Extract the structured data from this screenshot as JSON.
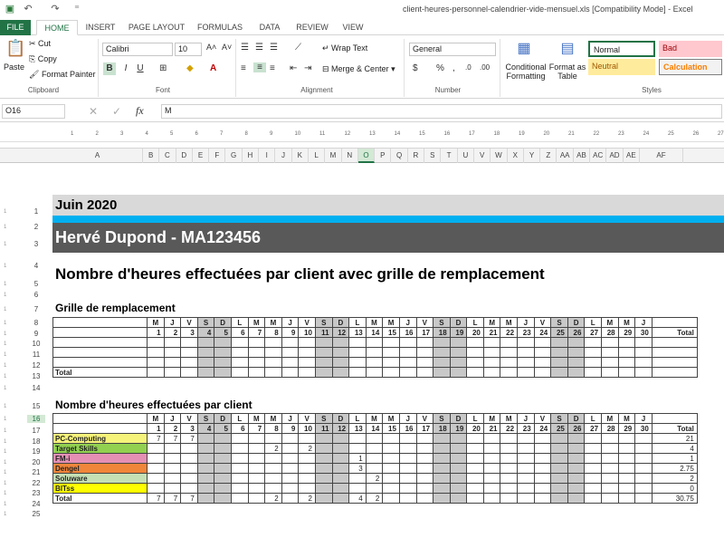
{
  "window": {
    "title": "client-heures-personnel-calendrier-vide-mensuel.xls  [Compatibility Mode] - Excel"
  },
  "tabs": [
    "FILE",
    "HOME",
    "INSERT",
    "PAGE LAYOUT",
    "FORMULAS",
    "DATA",
    "REVIEW",
    "VIEW"
  ],
  "ribbon": {
    "clipboard": {
      "paste": "Paste",
      "cut": "Cut",
      "copy": "Copy",
      "format_painter": "Format Painter",
      "label": "Clipboard"
    },
    "font": {
      "name": "Calibri",
      "size": "10",
      "label": "Font",
      "bold": "B",
      "italic": "I",
      "underline": "U"
    },
    "alignment": {
      "wrap": "Wrap Text",
      "merge": "Merge & Center",
      "label": "Alignment"
    },
    "number": {
      "format": "General",
      "label": "Number",
      "currency": "$",
      "percent": "%",
      "comma": ","
    },
    "styles": {
      "conditional": "Conditional Formatting",
      "format_table": "Format as Table",
      "normal": "Normal",
      "bad": "Bad",
      "neutral": "Neutral",
      "calculation": "Calculation",
      "label": "Styles"
    }
  },
  "formula_bar": {
    "name_box": "O16",
    "fx": "fx",
    "value": "M"
  },
  "ruler": [
    "1",
    "2",
    "3",
    "4",
    "5",
    "6",
    "7",
    "8",
    "9",
    "10",
    "11",
    "12",
    "13",
    "14",
    "15",
    "16",
    "17",
    "18",
    "19",
    "20",
    "21",
    "22",
    "23",
    "24",
    "25",
    "26",
    "27"
  ],
  "columns": [
    "A",
    "B",
    "C",
    "D",
    "E",
    "F",
    "G",
    "H",
    "I",
    "J",
    "K",
    "L",
    "M",
    "N",
    "O",
    "P",
    "Q",
    "R",
    "S",
    "T",
    "U",
    "V",
    "W",
    "X",
    "Y",
    "Z",
    "AA",
    "AB",
    "AC",
    "AD",
    "AE",
    "AF"
  ],
  "rows": [
    "1",
    "2",
    "3",
    "4",
    "5",
    "6",
    "7",
    "8",
    "9",
    "10",
    "11",
    "12",
    "13",
    "14",
    "15",
    "16",
    "17",
    "18",
    "19",
    "20",
    "21",
    "22",
    "23",
    "24",
    "25"
  ],
  "sheet": {
    "month": "Juin 2020",
    "employee": "Hervé Dupond -  MA123456",
    "heading": "Nombre d'heures effectuées par client avec grille de remplacement",
    "section1": "Grille de remplacement",
    "section2": "Nombre d'heures effectuées par client",
    "weekday_letters": [
      "M",
      "J",
      "V",
      "S",
      "D",
      "L",
      "M",
      "M",
      "J",
      "V",
      "S",
      "D",
      "L",
      "M",
      "M",
      "J",
      "V",
      "S",
      "D",
      "L",
      "M",
      "M",
      "J",
      "V",
      "S",
      "D",
      "L",
      "M",
      "M",
      "J"
    ],
    "day_numbers": [
      "1",
      "2",
      "3",
      "4",
      "5",
      "6",
      "7",
      "8",
      "9",
      "10",
      "11",
      "12",
      "13",
      "14",
      "15",
      "16",
      "17",
      "18",
      "19",
      "20",
      "21",
      "22",
      "23",
      "24",
      "25",
      "26",
      "27",
      "28",
      "29",
      "30"
    ],
    "total_label": "Total",
    "clients": [
      {
        "name": "PC-Computing",
        "color": "#f6f37a",
        "hours": {
          "1": "7",
          "2": "7",
          "3": "7"
        },
        "total": "21"
      },
      {
        "name": "Target Skills",
        "color": "#92d050",
        "hours": {
          "8": "2",
          "10": "2"
        },
        "total": "4"
      },
      {
        "name": "FM-i",
        "color": "#e58fb4",
        "hours": {
          "13": "1"
        },
        "total": "1"
      },
      {
        "name": "Dengel",
        "color": "#f0863a",
        "hours": {
          "13": "3"
        },
        "total": "2.75"
      },
      {
        "name": "Soluware",
        "color": "#c5e0b4",
        "hours": {
          "14": "2"
        },
        "total": "2"
      },
      {
        "name": "BITss",
        "color": "#ffff00",
        "hours": {},
        "total": "0"
      }
    ],
    "totals_row": {
      "1": "7",
      "2": "7",
      "3": "7",
      "8": "2",
      "10": "2",
      "13": "4",
      "14": "2"
    },
    "grand_total": "30.75"
  }
}
